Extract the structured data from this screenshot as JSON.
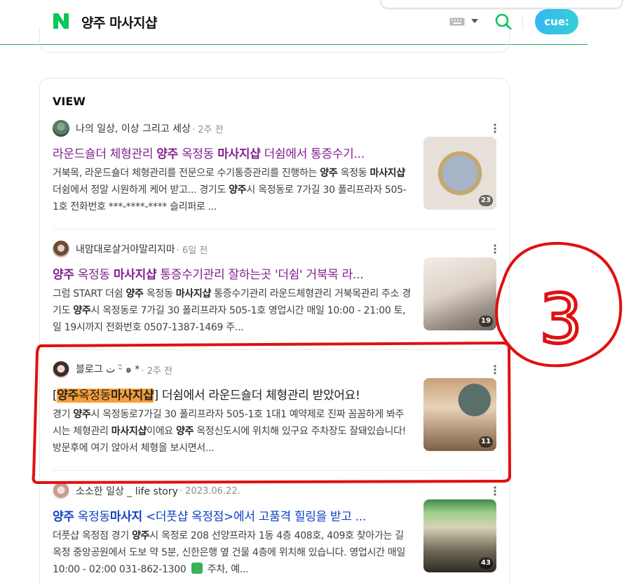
{
  "header": {
    "logo": "N",
    "query": "양주 마사지샵",
    "cue_label": "cue:"
  },
  "view": {
    "section_title": "VIEW",
    "items": [
      {
        "author": "나의 일상, 이상 그리고 세상",
        "time": "· 2주 전",
        "title_parts": [
          "라운드숄더 체형관리 ",
          "양주",
          " 옥정동 ",
          "마사지샵",
          " 더쉼에서 통증수기..."
        ],
        "desc_html": "거북목, 라운드숄더 체형관리를 전문으로 수기통증관리를 진행하는 <b>양주</b> 옥정동 <b>마사지샵</b> 더쉼에서 정말 시원하게 케어 받고... 경기도 <b>양주</b>시 옥정동로 7가길 30 폴리프라자 505-1호 전화번호 ***-****-**** 슬리퍼로 ...",
        "thumb_count": "23"
      },
      {
        "author": "내맘대로살거야말리지마",
        "time": "· 6일 전",
        "title_parts": [
          "양주",
          " 옥정동 ",
          "마사지샵",
          " 통증수기관리 잘하는곳 '더쉼' 거북목 라..."
        ],
        "desc_html": "그럼 START 더쉼 <b>양주</b> 옥정동 <b>마사지샵</b> 통증수기관리 라운드체형관리 거북목관리 주소 경기도 <b>양주</b>시 옥정동로 7가길 30 폴리프라자 505-1호 영업시간 매일 10:00 - 21:00 토,일 19시까지 전화번호 0507-1387-1469 주...",
        "thumb_count": "19"
      },
      {
        "author": "블로그 ت ᵕ̈ ๑ *",
        "time": "· 2주 전",
        "title_parts": [
          "[",
          "양주",
          "옥정동",
          "마사지샵",
          "] 더쉼에서 라운드숄더 체형관리 받았어요!"
        ],
        "desc_html": "경기 <b>양주</b>시 옥정동로7가길 30 폴리프라자 505-1호 1대1 예약제로 진짜 꼼꼼하게 봐주시는 체형관리 <b>마사지샵</b>이에요 <b>양주</b> 옥정신도시에 위치해 있구요 주차장도 잘돼있습니다! 방문후에 여기 앉아서 체형을 보시면서...",
        "thumb_count": "11"
      },
      {
        "author": "소소한 일상 _ life story",
        "time": "· 2023.06.22.",
        "title_parts": [
          "양주",
          " 옥정동",
          "마사지",
          " <더풋샵 옥정점>에서 고품격 힐링을 받고 ..."
        ],
        "desc_html": "더풋샵 옥정점 경기 <b>양주</b>시 옥정로 208 선양프라자 1동 4층 408호, 409호 찾아가는 길 옥정 중앙공원에서 도보 약 5분, 신한은행 옆 건물 4층에 위치해 있습니다. 영업시간 매일 10:00 - 02:00 031-862-1300 ",
        "desc_tail": " 주차, 예...",
        "thumb_count": "43"
      }
    ]
  },
  "annotation": {
    "label": "3",
    "color": "#e01010"
  }
}
